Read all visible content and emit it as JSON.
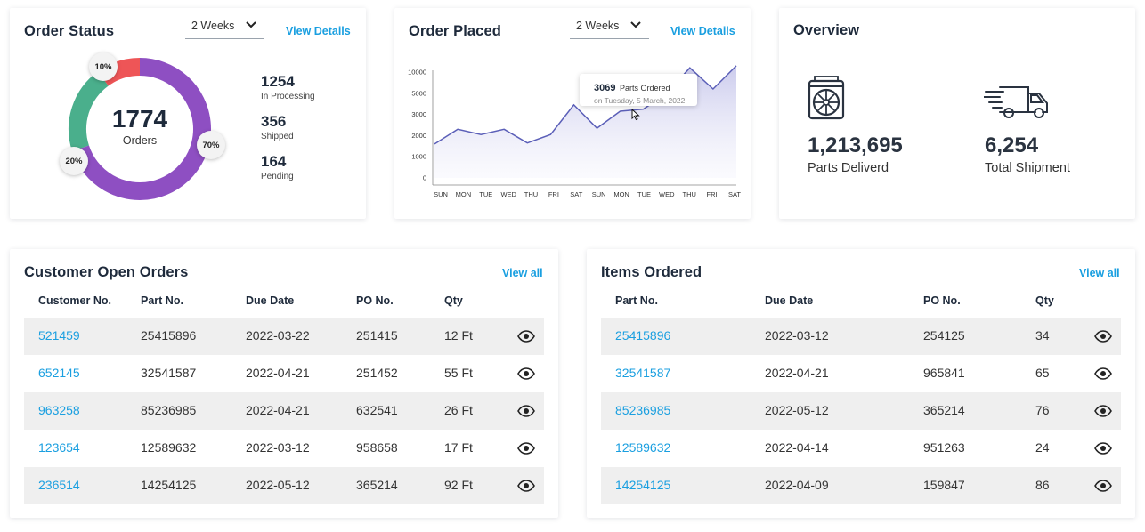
{
  "order_status": {
    "title": "Order Status",
    "period": "2 Weeks",
    "view_details": "View Details",
    "total": "1774",
    "total_label": "Orders",
    "segments": [
      {
        "label": "70%",
        "percent": 70,
        "color": "#8e4fc2"
      },
      {
        "label": "20%",
        "percent": 20,
        "color": "#4aaf8c"
      },
      {
        "label": "10%",
        "percent": 10,
        "color": "#ee5557"
      }
    ],
    "stats": [
      {
        "value": "1254",
        "label": "In Processing"
      },
      {
        "value": "356",
        "label": "Shipped"
      },
      {
        "value": "164",
        "label": "Pending"
      }
    ]
  },
  "order_placed": {
    "title": "Order Placed",
    "period": "2 Weeks",
    "view_details": "View Details",
    "tooltip": {
      "value": "3069",
      "label": "Parts Ordered",
      "date": "on Tuesday, 5 March, 2022"
    },
    "chart_data": {
      "type": "area",
      "x": [
        "SUN",
        "MON",
        "TUE",
        "WED",
        "THU",
        "FRI",
        "SAT",
        "SUN",
        "MON",
        "TUE",
        "WED",
        "THU",
        "FRI",
        "SAT"
      ],
      "series": [
        {
          "values": [
            1600,
            2300,
            2050,
            2300,
            1650,
            2050,
            3450,
            2350,
            3150,
            3250,
            4000,
            5200,
            4200,
            5300
          ],
          "color": "#5b5fb8"
        }
      ],
      "y_ticks": [
        "0",
        "1000",
        "2000",
        "3000",
        "5000",
        "10000"
      ],
      "y_tick_values": [
        0,
        1000,
        2000,
        3000,
        4000,
        5000
      ],
      "ylim": [
        0,
        5000
      ],
      "grid": false
    }
  },
  "overview": {
    "title": "Overview",
    "items": [
      {
        "value": "1,213,695",
        "label": "Parts Deliverd",
        "icon": "fan-unit-icon"
      },
      {
        "value": "6,254",
        "label": "Total Shipment",
        "icon": "delivery-truck-icon"
      }
    ]
  },
  "customer_orders": {
    "title": "Customer Open Orders",
    "view_all": "View all",
    "columns": [
      "Customer No.",
      "Part No.",
      "Due Date",
      "PO No.",
      "Qty"
    ],
    "rows": [
      [
        "521459",
        "25415896",
        "2022-03-22",
        "251415",
        "12 Ft"
      ],
      [
        "652145",
        "32541587",
        "2022-04-21",
        "251452",
        "55 Ft"
      ],
      [
        "963258",
        "85236985",
        "2022-04-21",
        "632541",
        "26 Ft"
      ],
      [
        "123654",
        "12589632",
        "2022-03-12",
        "958658",
        "17 Ft"
      ],
      [
        "236514",
        "14254125",
        "2022-05-12",
        "365214",
        "92 Ft"
      ]
    ]
  },
  "items_ordered": {
    "title": "Items Ordered",
    "view_all": "View all",
    "columns": [
      "Part No.",
      "Due Date",
      "PO No.",
      "Qty"
    ],
    "rows": [
      [
        "25415896",
        "2022-03-12",
        "254125",
        "34"
      ],
      [
        "32541587",
        "2022-04-21",
        "965841",
        "65"
      ],
      [
        "85236985",
        "2022-05-12",
        "365214",
        "76"
      ],
      [
        "12589632",
        "2022-04-14",
        "951263",
        "24"
      ],
      [
        "14254125",
        "2022-04-09",
        "159847",
        "86"
      ]
    ]
  },
  "colors": {
    "link": "#1a9fe0",
    "heading": "#1e2a3b",
    "row_shade": "#efefef",
    "line": "#5b5fb8"
  }
}
